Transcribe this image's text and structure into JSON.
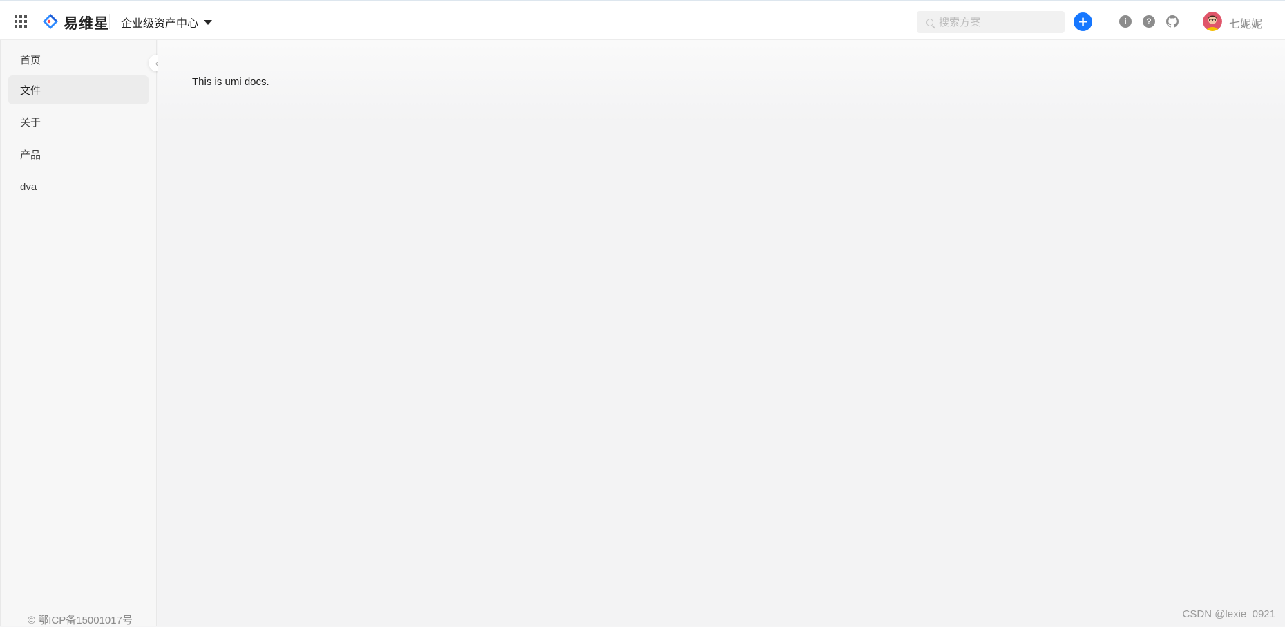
{
  "header": {
    "brand": "易维星",
    "scope_label": "企业级资产中心",
    "search_placeholder": "搜索方案",
    "add_label": "+",
    "info_label": "i",
    "help_label": "?",
    "username": "七妮妮"
  },
  "sidebar": {
    "items": [
      {
        "label": "首页"
      },
      {
        "label": "文件"
      },
      {
        "label": "关于"
      },
      {
        "label": "产品"
      },
      {
        "label": "dva"
      }
    ],
    "collapse_label": "‹",
    "footer": "© 鄂ICP备15001017号"
  },
  "main": {
    "text": "This is umi docs."
  },
  "watermark": "CSDN @lexie_0921",
  "colors": {
    "primary": "#1677ff",
    "active_bg": "#ececec"
  }
}
